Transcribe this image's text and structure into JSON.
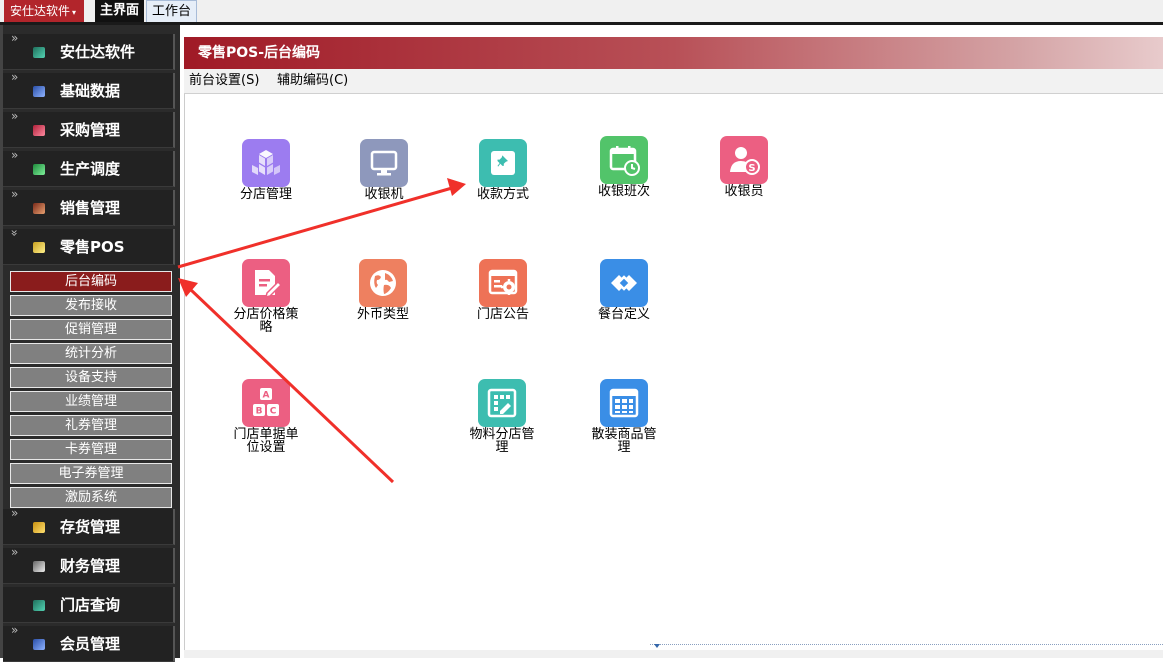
{
  "topbar": {
    "brand": "安仕达软件",
    "tabs": [
      "主界面",
      "工作台"
    ]
  },
  "sidebar": {
    "items": [
      {
        "label": "安仕达软件",
        "color": "#2aa198"
      },
      {
        "label": "基础数据",
        "color": "#4a7bd8"
      },
      {
        "label": "采购管理",
        "color": "#e0445a"
      },
      {
        "label": "生产调度",
        "color": "#3cc36a"
      },
      {
        "label": "销售管理",
        "color": "#c0504d"
      },
      {
        "label": "零售POS",
        "color": "#f0d24a",
        "expanded": true
      },
      {
        "label": "存货管理",
        "color": "#f0c040"
      },
      {
        "label": "财务管理",
        "color": "#9a9a9a"
      },
      {
        "label": "门店查询",
        "color": "#26a69a"
      },
      {
        "label": "会员管理",
        "color": "#4a7bd8"
      }
    ],
    "subitems": [
      "后台编码",
      "发布接收",
      "促销管理",
      "统计分析",
      "设备支持",
      "业绩管理",
      "礼券管理",
      "卡券管理",
      "电子券管理",
      "激励系统"
    ],
    "active_subitem": "后台编码"
  },
  "main": {
    "title": "零售POS-后台编码",
    "menu": [
      "前台设置(S)",
      "辅助编码(C)"
    ],
    "icons": [
      {
        "label": "分店管理",
        "icon": "cubes-icon",
        "color": "#9c7cf0"
      },
      {
        "label": "收银机",
        "icon": "monitor-icon",
        "color": "#8e98bc"
      },
      {
        "label": "收款方式",
        "icon": "pin-icon",
        "color": "#3dbdb0"
      },
      {
        "label": "收银班次",
        "icon": "calendar-clock-icon",
        "color": "#52c46a"
      },
      {
        "label": "收银员",
        "icon": "cashier-user-icon",
        "color": "#ec5f82"
      },
      {
        "label": "分店价格策略",
        "icon": "price-edit-icon",
        "color": "#ec5f82"
      },
      {
        "label": "外币类型",
        "icon": "globe-icon",
        "color": "#ee8060"
      },
      {
        "label": "门店公告",
        "icon": "notice-gear-icon",
        "color": "#ee7256"
      },
      {
        "label": "餐台定义",
        "icon": "link-diamond-icon",
        "color": "#3a8ee6"
      },
      {
        "label": "门店单据单位设置",
        "icon": "abc-blocks-icon",
        "color": "#ec5f82"
      },
      {
        "label": "物料分店管理",
        "icon": "grid-edit-icon",
        "color": "#3dbdb0"
      },
      {
        "label": "散装商品管理",
        "icon": "table-icon",
        "color": "#3a8ee6"
      }
    ]
  },
  "annotation_color": "#f0302a"
}
